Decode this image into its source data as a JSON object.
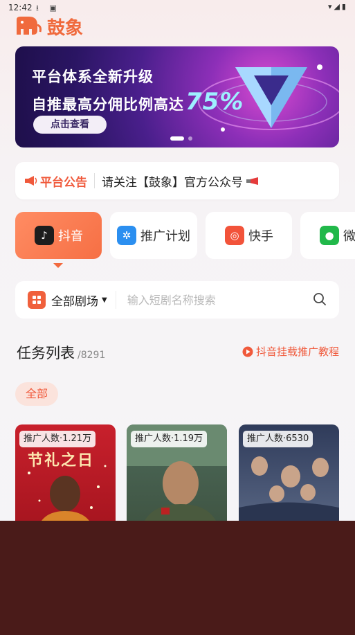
{
  "status_bar": {
    "time": "12:42"
  },
  "app": {
    "name": "鼓象"
  },
  "banner": {
    "line1": "平台体系全新升级",
    "line2": "自推最高分佣比例高达",
    "percent": "75%",
    "button": "点击查看"
  },
  "notice": {
    "title": "平台公告",
    "text": "请关注【鼓象】官方公众号"
  },
  "platform_tabs": [
    {
      "label": "抖音",
      "icon": "douyin-icon"
    },
    {
      "label": "推广计划",
      "icon": "promotion-plan-icon"
    },
    {
      "label": "快手",
      "icon": "kuaishou-icon"
    },
    {
      "label": "微",
      "icon": "wechat-icon"
    }
  ],
  "search": {
    "theater_label": "全部剧场",
    "placeholder": "输入短剧名称搜索"
  },
  "tasks": {
    "title": "任务列表",
    "count": "/8291",
    "tutorial_link": "抖音挂载推广教程"
  },
  "filters": [
    "全部"
  ],
  "cards": [
    {
      "badge": "推广人数·1.21万",
      "poster_title": "节礼之日"
    },
    {
      "badge": "推广人数·1.19万"
    },
    {
      "badge": "推广人数·6530"
    }
  ],
  "colors": {
    "accent": "#f0593b",
    "overlay": "#4a1b19"
  }
}
